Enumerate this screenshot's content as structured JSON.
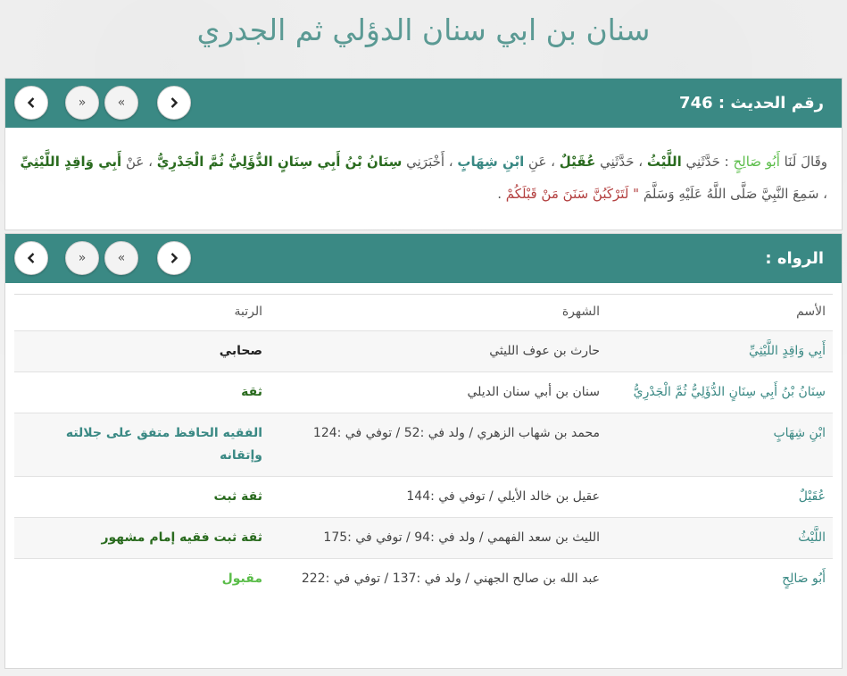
{
  "page_title": "سنان بن ابي سنان الدؤلي ثم الجدري",
  "hadith_card": {
    "title": "رقم الحديث : 746",
    "text": {
      "p1": "وقَالَ لَنَا ",
      "n1": "أَبُو صَالِحٍ",
      "p2": " : حَدَّثَنِي ",
      "n2": "اللَّيْثُ",
      "p3": " ، حَدَّثَنِي ",
      "n3": "عُقَيْلٌ",
      "p4": " ، عَنِ ",
      "n4": "ابْنِ شِهَابٍ",
      "p5": " ، أَخْبَرَنِي ",
      "n5": "سِنَانُ بْنُ أَبِي سِنَانٍ الدُّؤَلِيُّ ثُمَّ الْجَدْرِيُّ",
      "p6": " ، عَنْ ",
      "n6": "أَبِي وَاقِدٍ اللَّيْثِيِّ",
      "p7": " ، سَمِعَ النَّبِيَّ صَلَّى اللَّهُ عَلَيْهِ وَسَلَّمَ  ",
      "matn": "\" لَتَرْكَبُنَّ سَنَنَ مَنْ قَبْلَكُمْ",
      "end": " ."
    }
  },
  "narrators_card": {
    "title": "الرواه :",
    "columns": {
      "name": "الأسم",
      "fame": "الشهرة",
      "rank": "الرتبة"
    },
    "rows": [
      {
        "name": "أَبِي وَاقِدٍ اللَّيْثِيِّ",
        "fame": "حارث بن عوف الليثي",
        "rank": "صحابي",
        "rank_color": "#222222"
      },
      {
        "name": "سِنَانُ بْنُ أَبِي سِنَانٍ الدُّؤَلِيُّ ثُمَّ الْجَدْرِيُّ",
        "fame": "سنان بن أبي سنان الديلي",
        "rank": "ثقة",
        "rank_color": "#2a6b1f"
      },
      {
        "name": "ابْنِ شِهَابٍ",
        "fame": "محمد بن شهاب الزهري / ولد في :52 / توفي في :124",
        "rank": "الفقيه الحافظ متفق على جلالته وإتقانه",
        "rank_color": "#3a8984"
      },
      {
        "name": "عُقَيْلٌ",
        "fame": "عقيل بن خالد الأيلي / توفي في :144",
        "rank": "ثقة ثبت",
        "rank_color": "#2a6b1f"
      },
      {
        "name": "اللَّيْثُ",
        "fame": "الليث بن سعد الفهمي / ولد في :94 / توفي في :175",
        "rank": "ثقة ثبت فقيه إمام مشهور",
        "rank_color": "#2a6b1f"
      },
      {
        "name": "أَبُو صَالِحٍ",
        "fame": "عبد الله بن صالح الجهني / ولد في :137 / توفي في :222",
        "rank": "مقبول",
        "rank_color": "#5bbd4a"
      }
    ]
  },
  "nav_icons": {
    "prev": "chevron-right-icon",
    "first": "double-chevron-right-icon",
    "last": "double-chevron-left-icon",
    "next": "chevron-left-icon"
  },
  "colors": {
    "header": "#3a8984",
    "title": "#5b9a94",
    "accent_green": "#5bbd4a"
  }
}
